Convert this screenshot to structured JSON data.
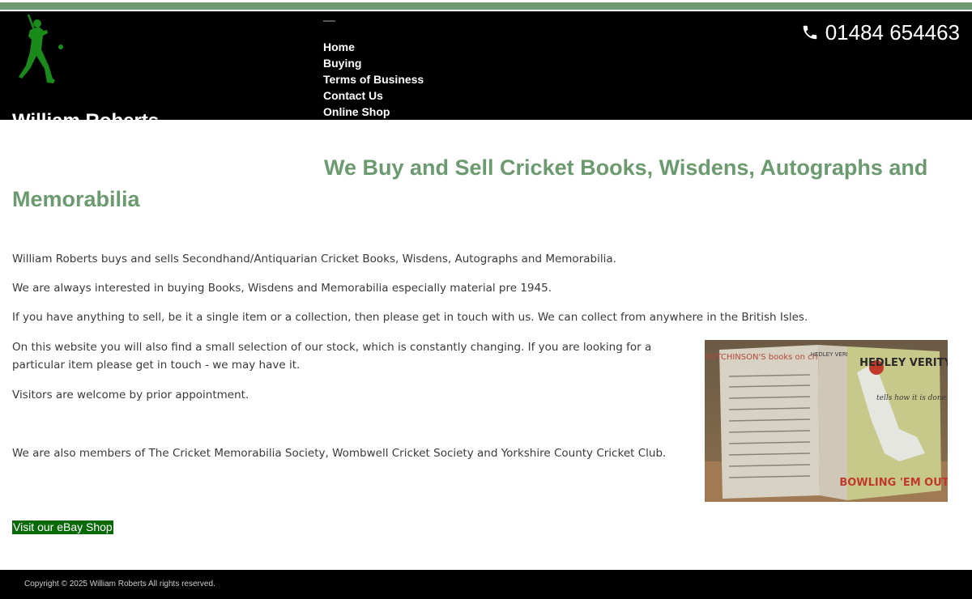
{
  "header": {
    "site_name": "William Roberts",
    "phone": "01484 654463",
    "logo_icon": "cricket-batsman-icon",
    "phone_icon": "phone-icon",
    "nav": [
      {
        "label": "Home"
      },
      {
        "label": "Buying"
      },
      {
        "label": "Terms of Business"
      },
      {
        "label": "Contact Us"
      },
      {
        "label": "Online Shop"
      }
    ]
  },
  "main": {
    "headline": "We Buy and Sell Cricket Books, Wisdens, Autographs and Memorabilia",
    "paragraphs": [
      "William Roberts buys and sells Secondhand/Antiquarian Cricket Books, Wisdens, Autographs and Memorabilia.",
      "We are always interested in buying Books, Wisdens and Memorabilia especially material pre 1945.",
      "If you have anything to sell, be it a single item or a collection, then please get in touch with us. We can collect from anywhere in the British Isles.",
      "On this website you will also find a small selection of our stock, which is constantly changing. If you are looking for a particular item please get in touch - we may have it.",
      "Visitors are welcome by prior appointment.",
      "We are also members of The Cricket Memorabilia Society, Wombwell Cricket Society and Yorkshire County Cricket Club."
    ],
    "ebay_link": "Visit our eBay Shop",
    "book_image": {
      "spine_title": "HUTCHINSON'S books on cricket",
      "spine_name": "HEDLEY VERITY",
      "cover_name": "HEDLEY VERITY",
      "cover_tagline": "tells how it is done",
      "cover_title": "BOWLING 'EM OUT"
    }
  },
  "footer": {
    "copyright": "Copyright © 2025 William Roberts All rights reserved."
  },
  "colors": {
    "accent_green": "#6b9a6e",
    "stripe": "#6f9a72",
    "logo_green": "#1a8a1a",
    "ebay_bg": "#0a6a0a",
    "header_bg": "#000000"
  }
}
